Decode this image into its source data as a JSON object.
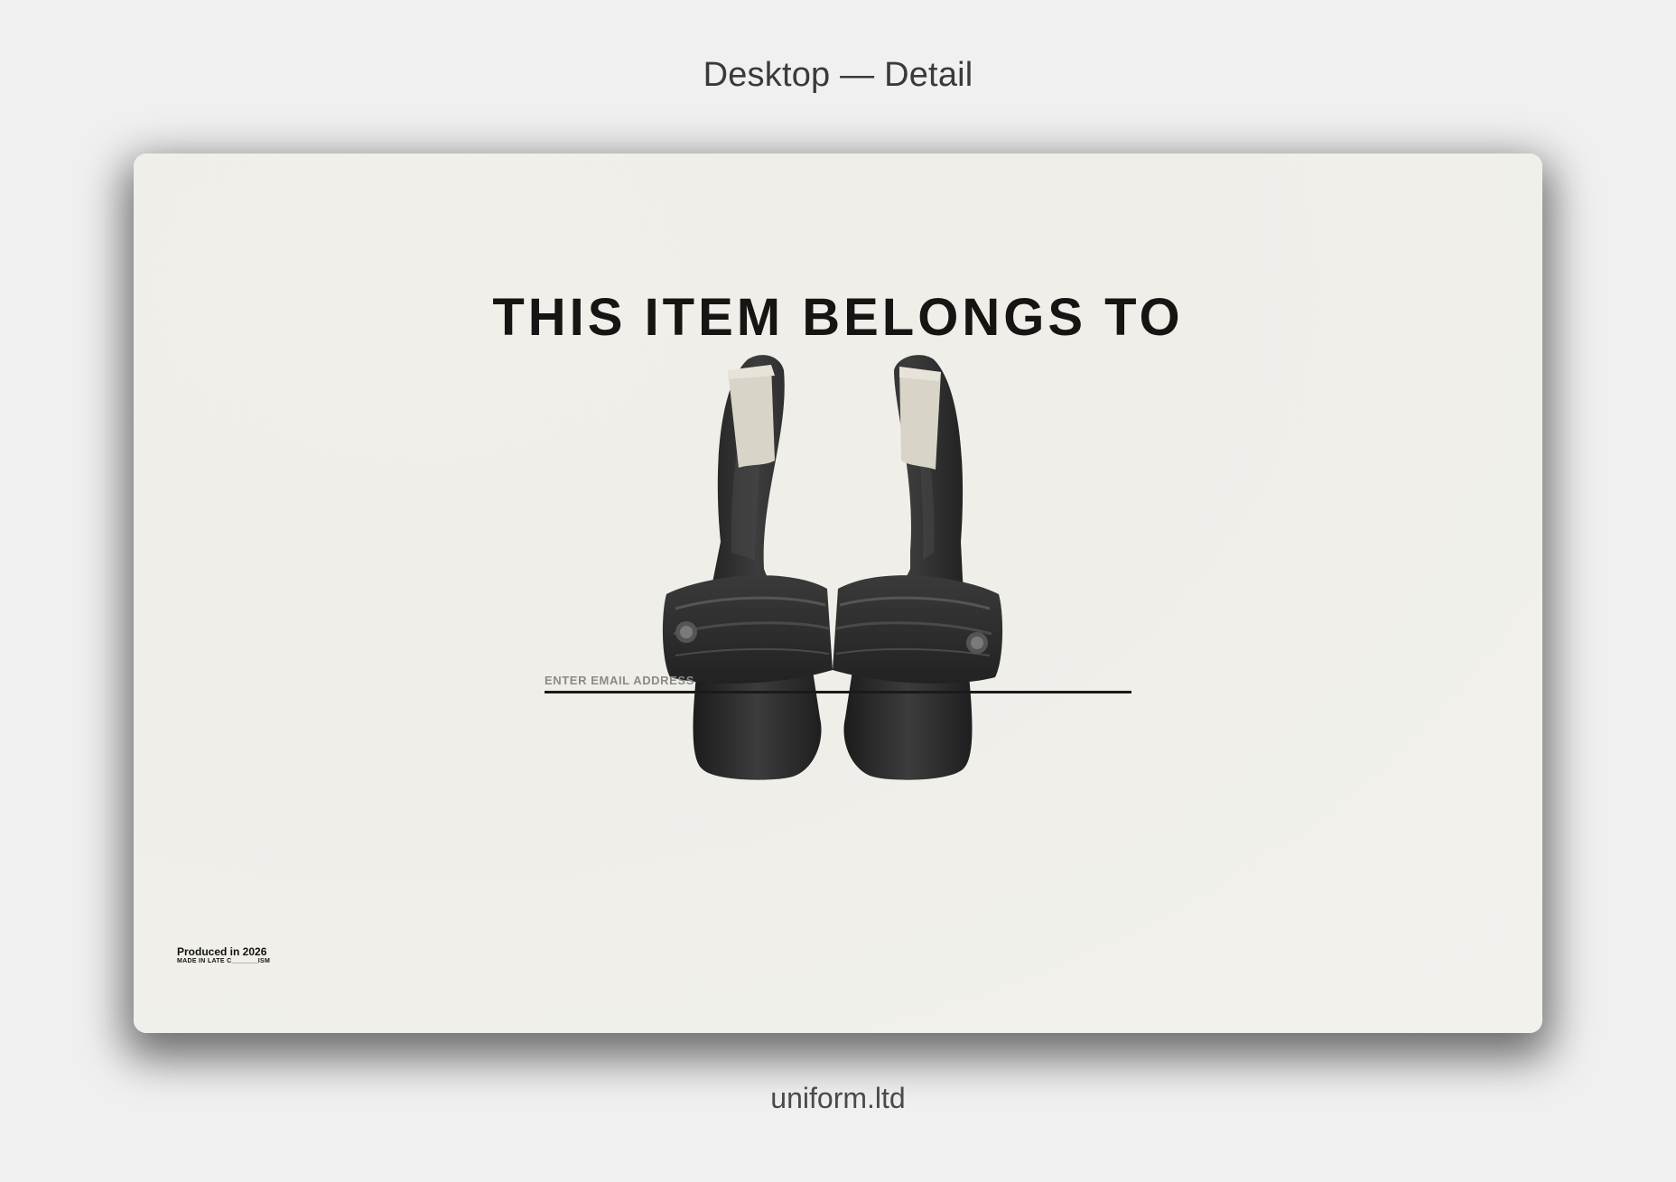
{
  "presentation": {
    "top_caption": "Desktop — Detail",
    "bottom_caption": "uniform.ltd"
  },
  "page": {
    "headline": "THIS ITEM BELONGS TO",
    "email": {
      "placeholder": "ENTER EMAIL ADDRESS",
      "value": ""
    },
    "footer": {
      "produced": "Produced in 2026",
      "made": "MADE IN LATE C_______ISM"
    }
  },
  "colors": {
    "page_background": "#f0f0f0",
    "frame_background": "#efeee9",
    "text_dark": "#161513",
    "shoe_leather": "#2a2a2a",
    "tape": "#d9d4c8"
  },
  "icons": {
    "product_image": "black-slide-sandals-with-tape"
  }
}
